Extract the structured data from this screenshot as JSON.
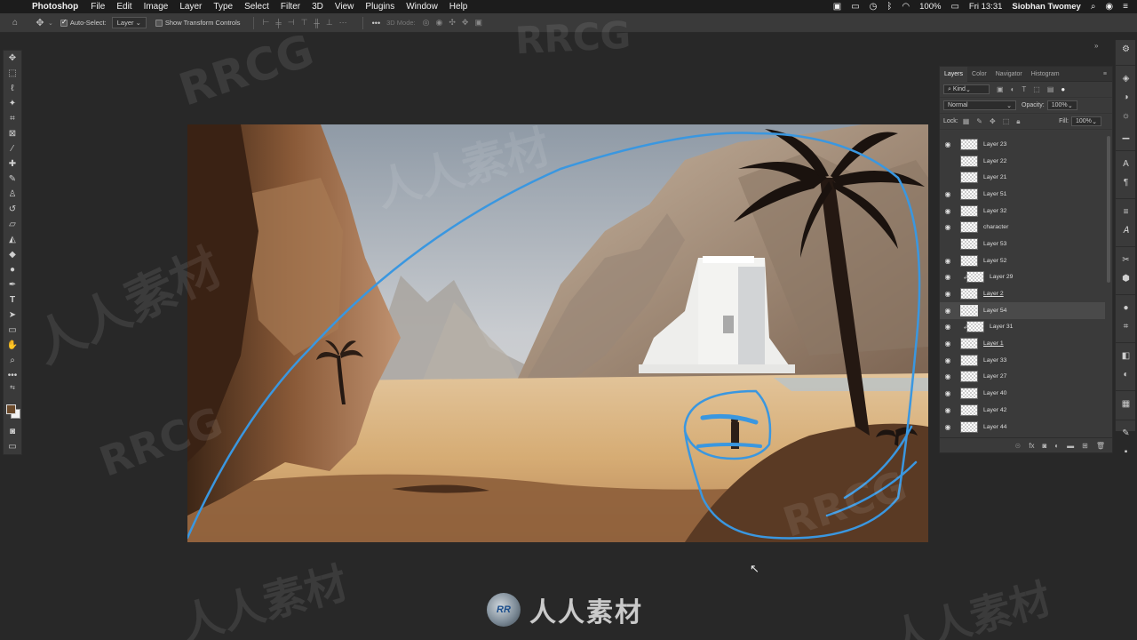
{
  "menubar": {
    "app_name": "Photoshop",
    "items": [
      "File",
      "Edit",
      "Image",
      "Layer",
      "Type",
      "Select",
      "Filter",
      "3D",
      "View",
      "Plugins",
      "Window",
      "Help"
    ],
    "battery": "100%",
    "clock": "Fri 13:31",
    "user": "Siobhan Twomey"
  },
  "options_bar": {
    "auto_select_label": "Auto-Select:",
    "auto_select_target": "Layer",
    "show_transform_label": "Show Transform Controls",
    "mode_3d_label": "3D Mode:"
  },
  "layers_panel": {
    "tabs": [
      "Layers",
      "Color",
      "Navigator",
      "Histogram"
    ],
    "kind_filter": "Kind",
    "blend_mode": "Normal",
    "opacity_label": "Opacity:",
    "opacity_value": "100%",
    "lock_label": "Lock:",
    "fill_label": "Fill:",
    "fill_value": "100%",
    "layers": [
      {
        "name": "Layer 23",
        "visible": true
      },
      {
        "name": "Layer 22",
        "visible": false
      },
      {
        "name": "Layer 21",
        "visible": false
      },
      {
        "name": "Layer 51",
        "visible": true
      },
      {
        "name": "Layer 32",
        "visible": true
      },
      {
        "name": "character",
        "visible": true
      },
      {
        "name": "Layer 53",
        "visible": false
      },
      {
        "name": "Layer 52",
        "visible": true
      },
      {
        "name": "Layer 29",
        "visible": true,
        "clipped": true
      },
      {
        "name": "Layer 2",
        "visible": true
      },
      {
        "name": "Layer 54",
        "visible": true,
        "selected": true
      },
      {
        "name": "Layer 31",
        "visible": true,
        "clipped": true
      },
      {
        "name": "Layer 1",
        "visible": true
      },
      {
        "name": "Layer 33",
        "visible": true
      },
      {
        "name": "Layer 27",
        "visible": true
      },
      {
        "name": "Layer 40",
        "visible": true
      },
      {
        "name": "Layer 42",
        "visible": true
      },
      {
        "name": "Layer 44",
        "visible": true
      }
    ]
  },
  "watermarks": {
    "latin": "RRCG",
    "cjk": "人人素材",
    "logo_text": "人人素材",
    "logo_badge": "RR"
  },
  "colors": {
    "foreground": "#6b4a2b",
    "background": "#f3f3f3",
    "stroke_blue": "#3a97e0"
  }
}
